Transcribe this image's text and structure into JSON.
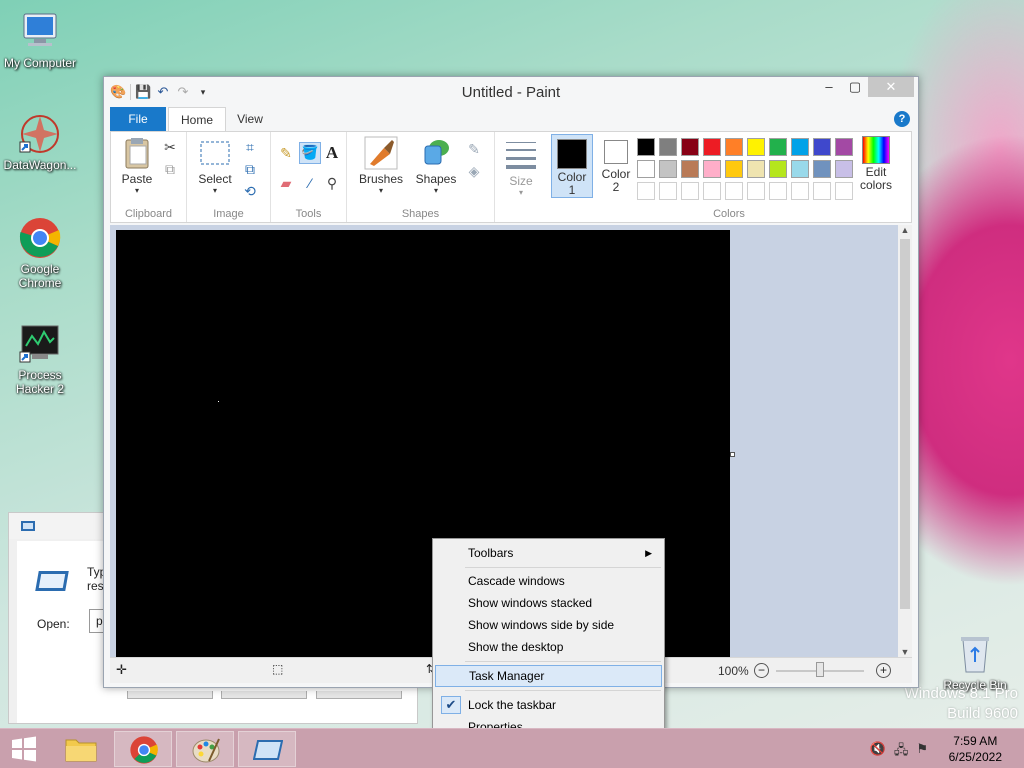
{
  "desktop": {
    "icons": [
      {
        "label": "My Computer"
      },
      {
        "label": "DataWagon..."
      },
      {
        "label": "Google Chrome"
      },
      {
        "label": "Process Hacker 2"
      },
      {
        "label": "Recycle Bin"
      }
    ],
    "watermark_line1": "Windows 8.1 Pro",
    "watermark_line2": "Build 9600"
  },
  "run_dialog": {
    "text_partial": "Type\nreso",
    "open_label": "Open:",
    "open_value": "p"
  },
  "paint": {
    "title": "Untitled - Paint",
    "tabs": {
      "file": "File",
      "home": "Home",
      "view": "View"
    },
    "groups": {
      "clipboard": {
        "name": "Clipboard",
        "paste": "Paste"
      },
      "image": {
        "name": "Image",
        "select": "Select"
      },
      "tools": {
        "name": "Tools"
      },
      "shapes": {
        "name": "Shapes",
        "brushes": "Brushes",
        "shapes": "Shapes"
      },
      "size": {
        "label": "Size"
      },
      "colors": {
        "name": "Colors",
        "color1": "Color\n1",
        "color2": "Color\n2",
        "edit": "Edit\ncolors"
      }
    },
    "palette": [
      "#000000",
      "#7f7f7f",
      "#880015",
      "#ed1c24",
      "#ff7f27",
      "#fff200",
      "#22b14c",
      "#00a2e8",
      "#3f48cc",
      "#a349a4",
      "#ffffff",
      "#c3c3c3",
      "#b97a57",
      "#ffaec9",
      "#ffc90e",
      "#efe4b0",
      "#b5e61d",
      "#99d9ea",
      "#7092be",
      "#c8bfe7",
      "#ffffff",
      "#ffffff",
      "#ffffff",
      "#ffffff",
      "#ffffff",
      "#ffffff",
      "#ffffff",
      "#ffffff",
      "#ffffff",
      "#ffffff"
    ],
    "zoom": "100%"
  },
  "context_menu": {
    "items": {
      "toolbars": "Toolbars",
      "cascade": "Cascade windows",
      "stacked": "Show windows stacked",
      "side_by_side": "Show windows side by side",
      "show_desktop": "Show the desktop",
      "task_manager": "Task Manager",
      "lock_taskbar": "Lock the taskbar",
      "properties": "Properties"
    }
  },
  "taskbar": {
    "time": "7:59 AM",
    "date": "6/25/2022"
  }
}
